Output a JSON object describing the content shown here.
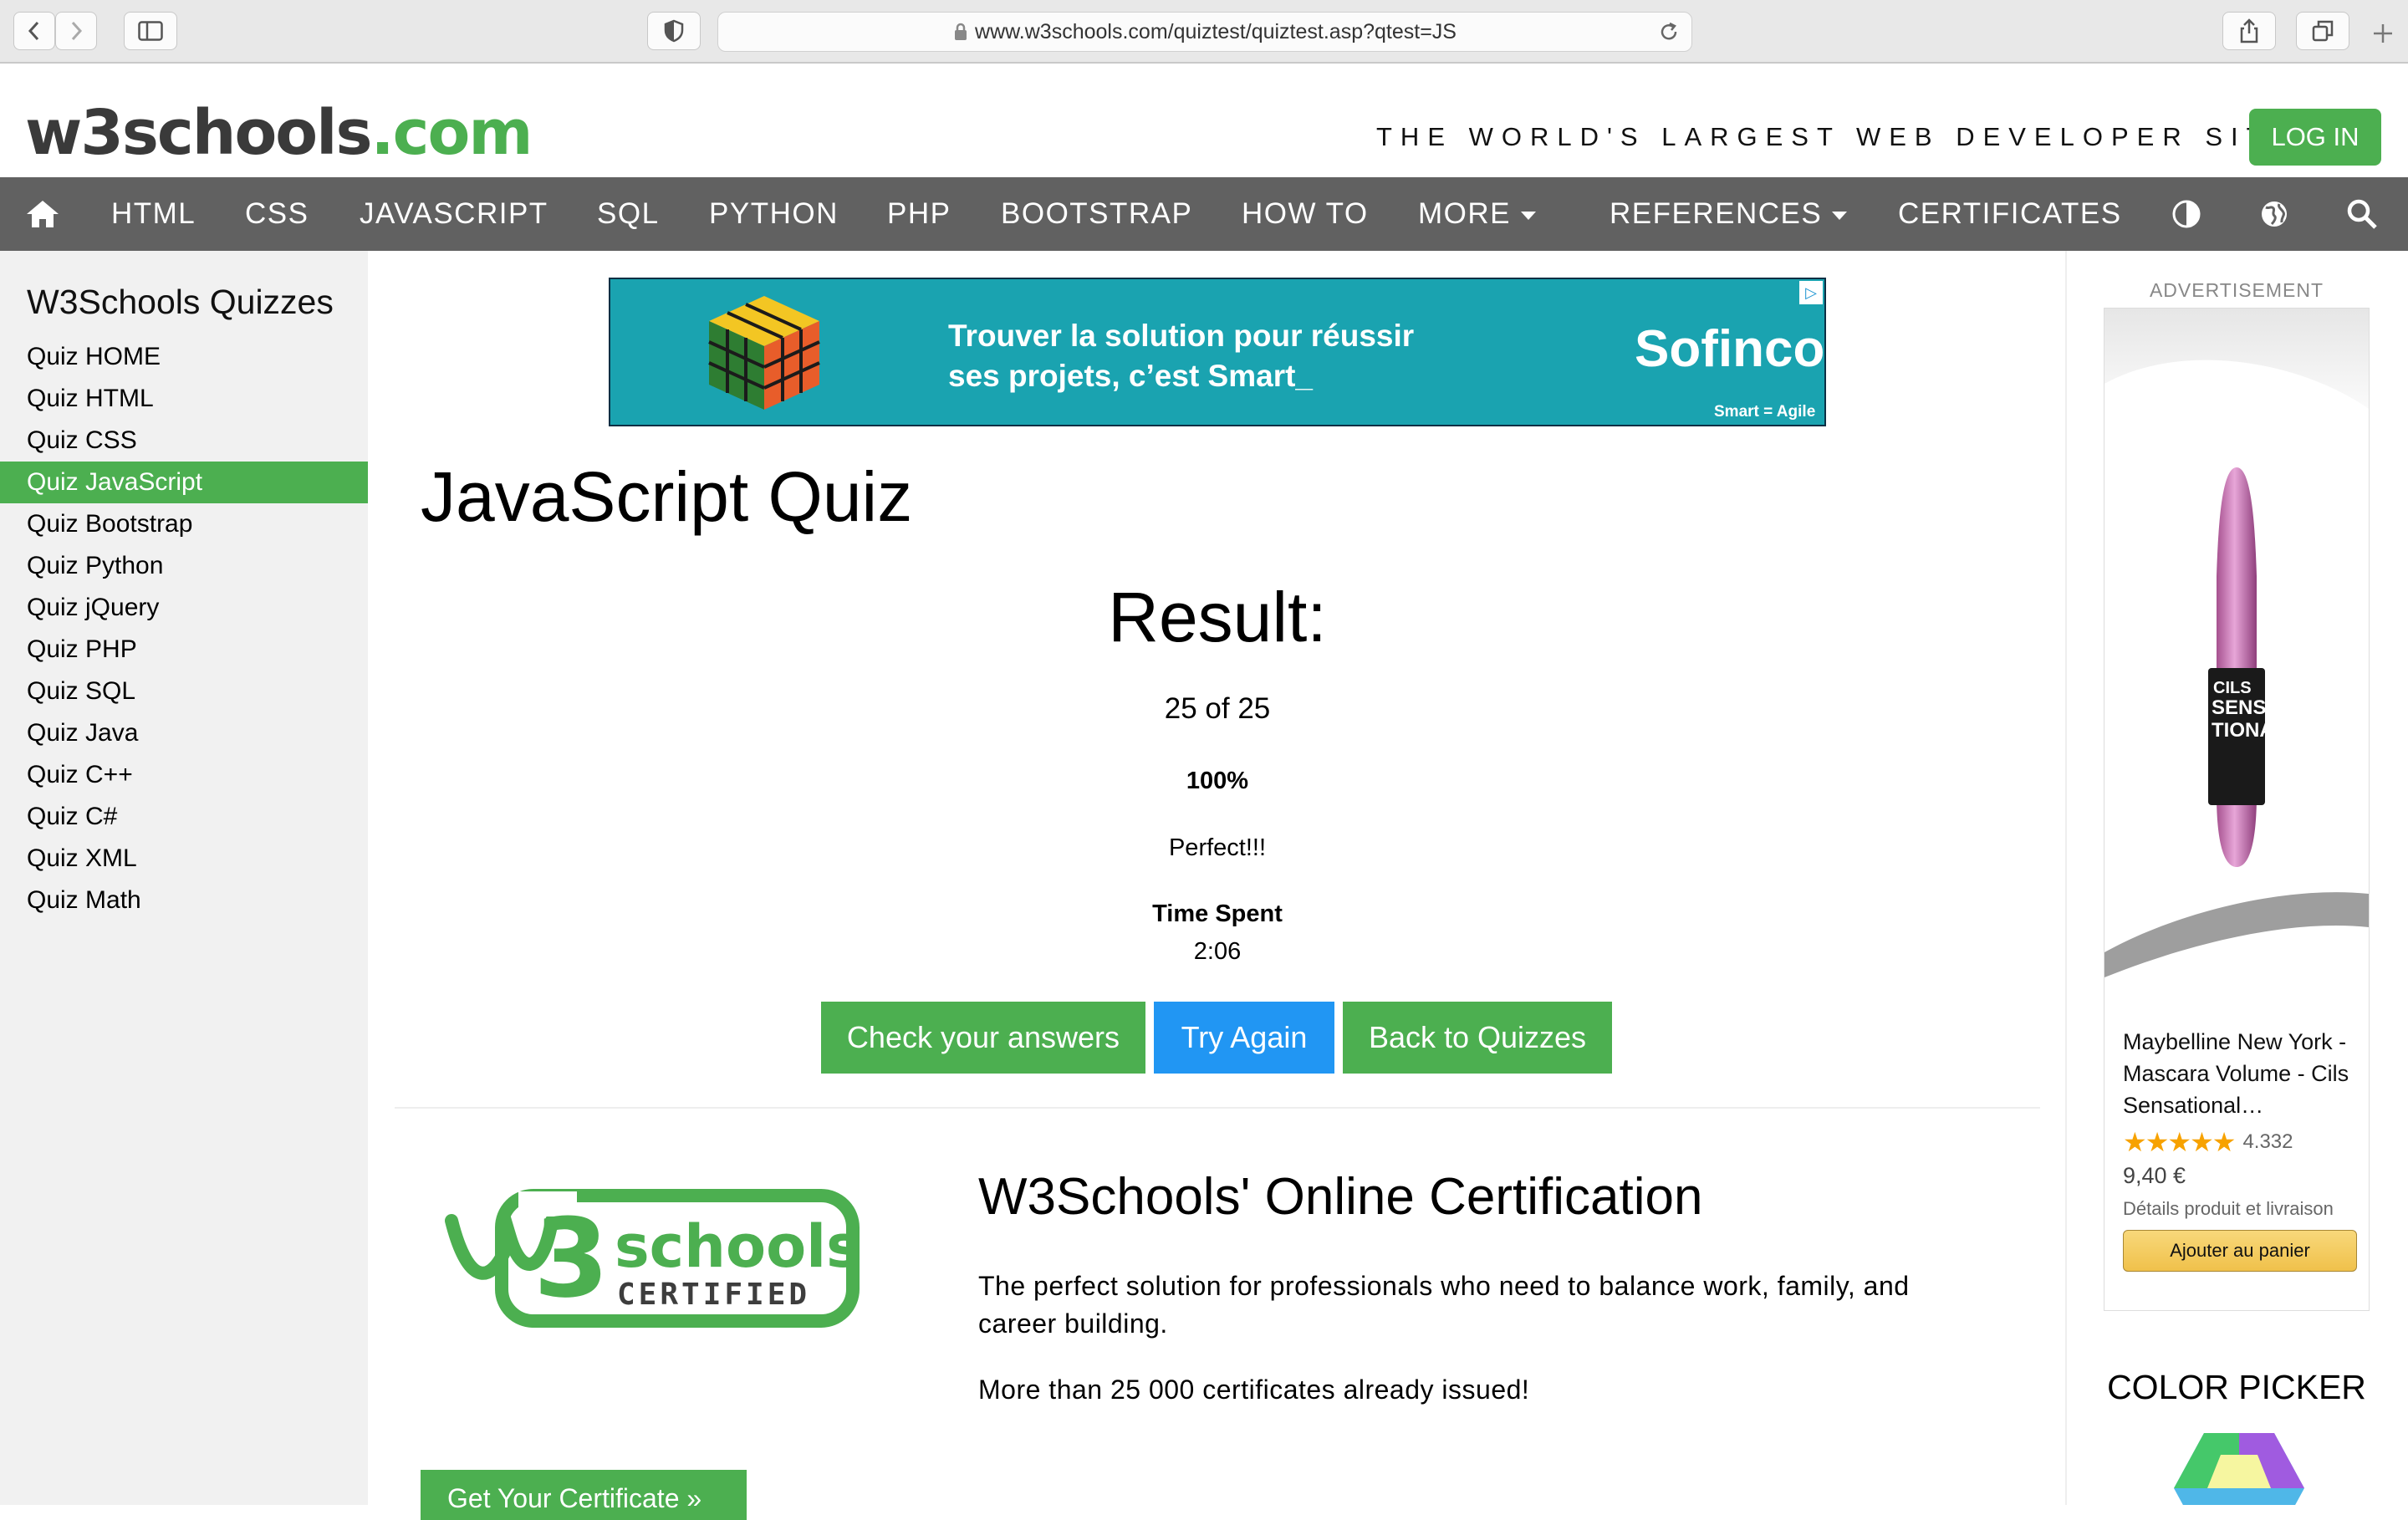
{
  "browser": {
    "url": "www.w3schools.com/quiztest/quiztest.asp?qtest=JS"
  },
  "header": {
    "logo_main": "w3schools",
    "logo_suffix": ".com",
    "tagline": "THE WORLD'S LARGEST WEB DEVELOPER SITE",
    "login_label": "LOG IN"
  },
  "topnav": {
    "items": [
      "HTML",
      "CSS",
      "JAVASCRIPT",
      "SQL",
      "PYTHON",
      "PHP",
      "BOOTSTRAP",
      "HOW TO",
      "MORE",
      "REFERENCES",
      "CERTIFICATES"
    ]
  },
  "sidebar": {
    "title": "W3Schools Quizzes",
    "items": [
      "Quiz HOME",
      "Quiz HTML",
      "Quiz CSS",
      "Quiz JavaScript",
      "Quiz Bootstrap",
      "Quiz Python",
      "Quiz jQuery",
      "Quiz PHP",
      "Quiz SQL",
      "Quiz Java",
      "Quiz C++",
      "Quiz C#",
      "Quiz XML",
      "Quiz Math"
    ],
    "active_index": 3
  },
  "banner_ad": {
    "line1": "Trouver la solution pour réussir",
    "line2": "ses projets, c’est Smart_",
    "brand": "Sofinco",
    "slogan": "Smart = Agile"
  },
  "main": {
    "title": "JavaScript Quiz",
    "result_heading": "Result:",
    "score": "25 of 25",
    "percent": "100%",
    "verdict": "Perfect!!!",
    "time_label": "Time Spent",
    "time_value": "2:06",
    "buttons": {
      "check": "Check your answers",
      "again": "Try Again",
      "back": "Back to Quizzes"
    }
  },
  "certification": {
    "title": "W3Schools' Online Certification",
    "description": "The perfect solution for professionals who need to balance work, family, and career building.",
    "count_text": "More than 25 000 certificates already issued!",
    "cta": "Get Your Certificate »",
    "logo_word1": "schools",
    "logo_word2": "CERTIFIED"
  },
  "right": {
    "ad_label": "ADVERTISEMENT",
    "product": {
      "title": "Maybelline New York - Mascara Volume - Cils Sensational…",
      "rating_count": "4.332",
      "price": "9,40 €",
      "details": "Détails produit et livraison",
      "cart": "Ajouter au panier",
      "rating": 4.5
    },
    "color_picker_title": "COLOR PICKER"
  },
  "colors": {
    "green": "#4CAF50",
    "blue": "#2196F3",
    "nav_bg": "#616161",
    "sidebar_bg": "#f1f1f1"
  }
}
